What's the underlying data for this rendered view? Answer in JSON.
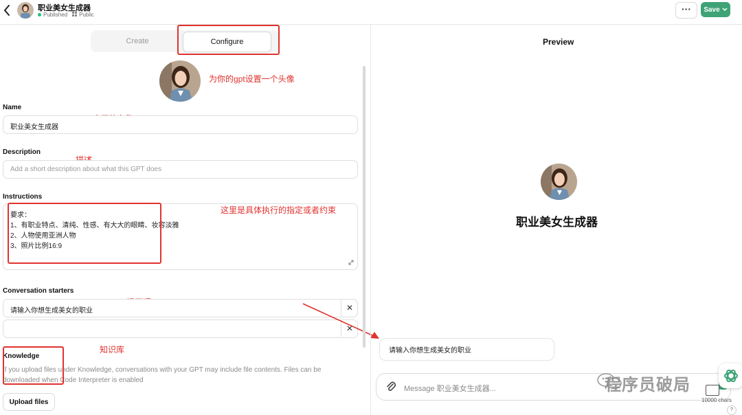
{
  "header": {
    "title": "职业美女生成器",
    "status": "Published",
    "visibility": "Public",
    "more_label": "···",
    "save_label": "Save",
    "back_icon": "chevron-left-icon",
    "accent_color": "#3ea376"
  },
  "tabs": [
    {
      "label": "Create"
    },
    {
      "label": "Configure"
    }
  ],
  "form": {
    "name_label": "Name",
    "name_value": "职业美女生成器",
    "description_label": "Description",
    "description_placeholder": "Add a short description about what this GPT does",
    "instructions_label": "Instructions",
    "instructions_lines": [
      "要求：",
      "1、有职业特点、清纯、性感、有大大的眼睛、妆容淡雅",
      "2、人物使用亚洲人物",
      "3、照片比例16:9"
    ],
    "starters_label": "Conversation starters",
    "starters": [
      "请输入你想生成美女的职业",
      ""
    ],
    "knowledge_label": "Knowledge",
    "knowledge_help_1": "If you upload files under Knowledge, conversations with your GPT may include file contents. Files can be",
    "knowledge_help_2": "downloaded when Code Interpreter is enabled",
    "upload_label": "Upload files"
  },
  "annotations": {
    "avatar_note": "为你的gpt设置一个头像",
    "name_note": "gpt应用的名称",
    "description_note": "描述",
    "instructions_note": "这里是具体执行的指定或者约束",
    "starters_note": "提示语",
    "knowledge_note": "知识库",
    "annotation_color": "#e0322e"
  },
  "preview": {
    "title": "Preview",
    "gpt_name": "职业美女生成器",
    "starter_chip": "请输入你想生成美女的职业",
    "message_placeholder": "Message 职业美女生成器...",
    "chars_label": "10000 chars",
    "help_label": "?"
  },
  "watermark": {
    "text": "程序员破局"
  }
}
